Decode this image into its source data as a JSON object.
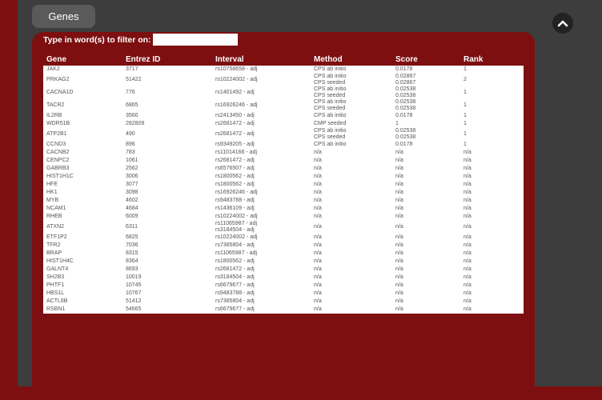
{
  "tab": {
    "label": "Genes"
  },
  "filter": {
    "label": "Type in word(s) to filter on:",
    "value": ""
  },
  "table": {
    "headers": [
      "Gene",
      "Entrez ID",
      "Interval",
      "Method",
      "Score",
      "Rank"
    ],
    "rows": [
      [
        "JAK2",
        "3717",
        [
          "rs10758658 - adj"
        ],
        [
          "CPS ab initio"
        ],
        [
          "0.0178"
        ],
        "1"
      ],
      [
        "PRKAG2",
        "51422",
        [
          "rs10224002 - adj"
        ],
        [
          "CPS ab initio",
          "CPS seeded"
        ],
        [
          "0.02867",
          "0.02867"
        ],
        "2"
      ],
      [
        "CACNA1D",
        "776",
        [
          "rs1401492 - adj"
        ],
        [
          "CPS ab initio",
          "CPS seeded"
        ],
        [
          "0.02538",
          "0.02538"
        ],
        "1"
      ],
      [
        "TACR2",
        "6865",
        [
          "rs16926246 - adj"
        ],
        [
          "CPS ab initio",
          "CPS seeded"
        ],
        [
          "0.02538",
          "0.02538"
        ],
        "1"
      ],
      [
        "IL2RB",
        "3560",
        [
          "rs2413450 - adj"
        ],
        [
          "CPS ab initio"
        ],
        [
          "0.0178"
        ],
        "1"
      ],
      [
        "WDR51B",
        "282809",
        [
          "rs2681472 - adj"
        ],
        [
          "CMP seeded"
        ],
        [
          "1"
        ],
        "1"
      ],
      [
        "ATP2B1",
        "490",
        [
          "rs2681472 - adj"
        ],
        [
          "CPS ab initio",
          "CPS seeded"
        ],
        [
          "0.02538",
          "0.02538"
        ],
        "1"
      ],
      [
        "CCND3",
        "896",
        [
          "rs9349205 - adj"
        ],
        [
          "CPS ab initio"
        ],
        [
          "0.0178"
        ],
        "1"
      ],
      [
        "CACNB2",
        "783",
        [
          "rs11014166 - adj"
        ],
        [
          "n/a"
        ],
        [
          "n/a"
        ],
        "n/a"
      ],
      [
        "CENPC2",
        "1061",
        [
          "rs2681472 - adj"
        ],
        [
          "n/a"
        ],
        [
          "n/a"
        ],
        "n/a"
      ],
      [
        "GABRB3",
        "2562",
        [
          "rs6576507 - adj"
        ],
        [
          "n/a"
        ],
        [
          "n/a"
        ],
        "n/a"
      ],
      [
        "HIST1H1C",
        "3006",
        [
          "rs1800562 - adj"
        ],
        [
          "n/a"
        ],
        [
          "n/a"
        ],
        "n/a"
      ],
      [
        "HFE",
        "3077",
        [
          "rs1800562 - adj"
        ],
        [
          "n/a"
        ],
        [
          "n/a"
        ],
        "n/a"
      ],
      [
        "HK1",
        "3098",
        [
          "rs16926246 - adj"
        ],
        [
          "n/a"
        ],
        [
          "n/a"
        ],
        "n/a"
      ],
      [
        "MYB",
        "4602",
        [
          "rs9483788 - adj"
        ],
        [
          "n/a"
        ],
        [
          "n/a"
        ],
        "n/a"
      ],
      [
        "NCAM1",
        "4684",
        [
          "rs1436109 - adj"
        ],
        [
          "n/a"
        ],
        [
          "n/a"
        ],
        "n/a"
      ],
      [
        "RHEB",
        "6009",
        [
          "rs10224002 - adj"
        ],
        [
          "n/a"
        ],
        [
          "n/a"
        ],
        "n/a"
      ],
      [
        "ATXN2",
        "6311",
        [
          "rs11065987 - adj",
          "rs3184504 - adj"
        ],
        [
          "n/a"
        ],
        [
          "n/a"
        ],
        "n/a"
      ],
      [
        "ETF1P2",
        "6825",
        [
          "rs10224002 - adj"
        ],
        [
          "n/a"
        ],
        [
          "n/a"
        ],
        "n/a"
      ],
      [
        "TFR2",
        "7036",
        [
          "rs7385804 - adj"
        ],
        [
          "n/a"
        ],
        [
          "n/a"
        ],
        "n/a"
      ],
      [
        "BRAP",
        "8315",
        [
          "rs11065987 - adj"
        ],
        [
          "n/a"
        ],
        [
          "n/a"
        ],
        "n/a"
      ],
      [
        "HIST1H4C",
        "8364",
        [
          "rs1800562 - adj"
        ],
        [
          "n/a"
        ],
        [
          "n/a"
        ],
        "n/a"
      ],
      [
        "GALNT4",
        "8693",
        [
          "rs2681472 - adj"
        ],
        [
          "n/a"
        ],
        [
          "n/a"
        ],
        "n/a"
      ],
      [
        "SH2B3",
        "10019",
        [
          "rs3184504 - adj"
        ],
        [
          "n/a"
        ],
        [
          "n/a"
        ],
        "n/a"
      ],
      [
        "PHTF1",
        "10745",
        [
          "rs6679677 - adj"
        ],
        [
          "n/a"
        ],
        [
          "n/a"
        ],
        "n/a"
      ],
      [
        "HBS1L",
        "10767",
        [
          "rs9483788 - adj"
        ],
        [
          "n/a"
        ],
        [
          "n/a"
        ],
        "n/a"
      ],
      [
        "ACTL6B",
        "51412",
        [
          "rs7385804 - adj"
        ],
        [
          "n/a"
        ],
        [
          "n/a"
        ],
        "n/a"
      ],
      [
        "RSBN1",
        "54665",
        [
          "rs6679677 - adj"
        ],
        [
          "n/a"
        ],
        [
          "n/a"
        ],
        "n/a"
      ]
    ]
  }
}
